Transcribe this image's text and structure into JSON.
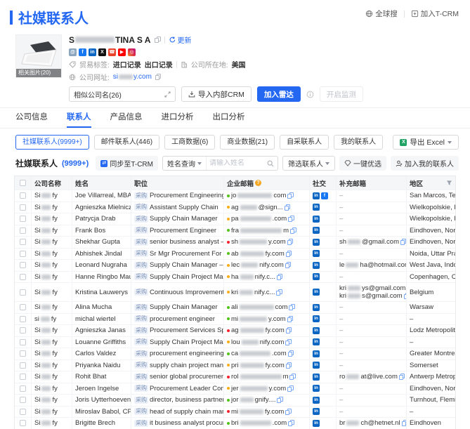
{
  "header": {
    "title": "社媒联系人"
  },
  "top_actions": {
    "global_search": "全球搜",
    "add_tcrm": "加入T-CRM"
  },
  "company": {
    "name_start": "S",
    "name_end": "TINA S A",
    "refresh_label": "更新",
    "image_label": "相关图片(20)",
    "social_platforms": [
      "website",
      "facebook",
      "linkedin",
      "x",
      "phone",
      "youtube",
      "instagram"
    ],
    "trade_label": "贸易标签:",
    "import_records": "进口记录",
    "export_records": "出口记录",
    "location_label": "公司所在地:",
    "location_value": "美国",
    "website_label": "公司网址:",
    "website_start": "si",
    "website_end": "y.com",
    "similar_companies": "相似公司名(26)",
    "import_crm": "导入内部CRM",
    "add_radar": "加入雷达",
    "start_monitor": "开启监测"
  },
  "tabs": [
    {
      "label": "公司信息",
      "active": false
    },
    {
      "label": "联系人",
      "active": true
    },
    {
      "label": "产品信息",
      "active": false
    },
    {
      "label": "进口分析",
      "active": false
    },
    {
      "label": "出口分析",
      "active": false
    }
  ],
  "filters": {
    "pills": [
      {
        "label": "社媒联系人(9999+)",
        "active": true
      },
      {
        "label": "邮件联系人(446)",
        "active": false
      },
      {
        "label": "工商数据(6)",
        "active": false
      },
      {
        "label": "商业数据(21)",
        "active": false
      },
      {
        "label": "自采联系人",
        "active": false
      },
      {
        "label": "我的联系人",
        "active": false
      }
    ],
    "export_label": "导出 Excel"
  },
  "toolbar": {
    "section_title": "社媒联系人",
    "section_count": "(9999+)",
    "sync_label": "同步至T-CRM",
    "name_query": "姓名查询",
    "search_placeholder": "请输入姓名",
    "filter_contacts": "筛选联系人",
    "one_click": "一键优选",
    "add_my_contacts": "加入我的联系人"
  },
  "table": {
    "columns": [
      "公司名称",
      "姓名",
      "职位",
      "企业邮箱",
      "社交",
      "补充邮箱",
      "地区"
    ],
    "tag_label": "采购",
    "empty_placeholder": "–",
    "rows": [
      {
        "company": {
          "pre": "Si",
          "post": "fy"
        },
        "name": "Joe Villarreal, MBA",
        "position": "Procurement Engineering",
        "email": {
          "status": "green",
          "pre": "jo",
          "post": "com"
        },
        "social": [
          "linkedin",
          "facebook"
        ],
        "extra": [],
        "region": "San Marcos, Texas,..."
      },
      {
        "company": {
          "pre": "Si",
          "post": "fy"
        },
        "name": "Agnieszka Mielniczuk",
        "position": "Assistant Supply Chain",
        "email": {
          "status": "yellow",
          "pre": "ag",
          "post": "@sign..."
        },
        "social": [
          "linkedin"
        ],
        "extra": [],
        "region": "Wielkopolskie, Poland"
      },
      {
        "company": {
          "pre": "Si",
          "post": "fy"
        },
        "name": "Patrycja Drab",
        "position": "Supply Chain Manager",
        "email": {
          "status": "yellow",
          "pre": "pa",
          "post": ".com"
        },
        "social": [
          "linkedin"
        ],
        "extra": [],
        "region": "Wielkopolskie, Poland"
      },
      {
        "company": {
          "pre": "Si",
          "post": "fy"
        },
        "name": "Frank Bos",
        "position": "Procurement Engineer",
        "email": {
          "status": "green",
          "pre": "fra",
          "post": "m"
        },
        "social": [
          "linkedin"
        ],
        "extra": [],
        "region": "Eindhoven, North Br..."
      },
      {
        "company": {
          "pre": "Si",
          "post": "fy"
        },
        "name": "Shekhar Gupta",
        "position": "senior business analyst – scm...",
        "email": {
          "status": "red",
          "pre": "sh",
          "post": "y.com"
        },
        "social": [
          "linkedin"
        ],
        "extra": [
          {
            "pre": "sh",
            "post": "@gmail.com"
          }
        ],
        "region": "Eindhoven, North Br..."
      },
      {
        "company": {
          "pre": "Si",
          "post": "fy"
        },
        "name": "Abhishek Jindal",
        "position": "Sr Mgr Procurement For Led ...",
        "email": {
          "status": "green",
          "pre": "ab",
          "post": "fy.com"
        },
        "social": [
          "linkedin"
        ],
        "extra": [],
        "region": "Noida, Uttar Prades..."
      },
      {
        "company": {
          "pre": "Si",
          "post": "fy"
        },
        "name": "Leonard Nugraha",
        "position": "Supply Chain Manager – Finis...",
        "email": {
          "status": "yellow",
          "pre": "lec",
          "post": "nify.com"
        },
        "social": [
          "linkedin"
        ],
        "extra": [
          {
            "pre": "le",
            "post": "ha@hotmail.com"
          }
        ],
        "region": "West Java, Indonesia"
      },
      {
        "company": {
          "pre": "Si",
          "post": "fy"
        },
        "name": "Hanne Ringbo Maur...",
        "position": "Supply Chain Project Manager",
        "email": {
          "status": "yellow",
          "pre": "ha",
          "post": "nify.c..."
        },
        "social": [
          "linkedin"
        ],
        "extra": [],
        "region": "Copenhagen, Capit..."
      },
      {
        "company": {
          "pre": "Si",
          "post": "fy"
        },
        "name": "Kristina Lauwerys",
        "position": "Continuous Improvement Man...",
        "email": {
          "status": "yellow",
          "pre": "kri",
          "post": "nify.c..."
        },
        "social": [
          "linkedin"
        ],
        "extra": [
          {
            "pre": "kri",
            "post": "ys@gmail.com"
          },
          {
            "pre": "kri",
            "post": "s@gmail.com"
          }
        ],
        "region": "Belgium"
      },
      {
        "company": {
          "pre": "Si",
          "post": "fy"
        },
        "name": "Alina Mucha",
        "position": "Supply Chain Manager",
        "email": {
          "status": "green",
          "pre": "ali",
          "post": "com"
        },
        "social": [
          "linkedin"
        ],
        "extra": [],
        "region": "Warsaw"
      },
      {
        "company": {
          "pre": "si",
          "post": "fy"
        },
        "name": "michal wiertel",
        "position": "procurement engineer",
        "email": {
          "status": "green",
          "pre": "mi",
          "post": "y.com"
        },
        "social": [
          "linkedin"
        ],
        "extra": [],
        "region": "–"
      },
      {
        "company": {
          "pre": "Si",
          "post": "fy"
        },
        "name": "Agnieszka Janas",
        "position": "Procurement Services Specialist",
        "email": {
          "status": "red",
          "pre": "ag",
          "post": "fy.com"
        },
        "social": [
          "linkedin"
        ],
        "extra": [],
        "region": "Lodz Metropolitan ..."
      },
      {
        "company": {
          "pre": "Si",
          "post": "fy"
        },
        "name": "Louanne Griffiths",
        "position": "Supply Chain Project Manager",
        "email": {
          "status": "yellow",
          "pre": "lou",
          "post": "nify.com"
        },
        "social": [
          "linkedin"
        ],
        "extra": [],
        "region": "–"
      },
      {
        "company": {
          "pre": "Si",
          "post": "fy"
        },
        "name": "Carlos Valdez",
        "position": "procurement engineering",
        "email": {
          "status": "green",
          "pre": "ca",
          "post": ".com"
        },
        "social": [
          "linkedin"
        ],
        "extra": [],
        "region": "Greater Montreal M..."
      },
      {
        "company": {
          "pre": "Si",
          "post": "fy"
        },
        "name": "Priyanka Naidu",
        "position": "supply chain project manager",
        "email": {
          "status": "yellow",
          "pre": "pri",
          "post": "fy.com"
        },
        "social": [
          "linkedin"
        ],
        "extra": [],
        "region": "Somerset"
      },
      {
        "company": {
          "pre": "Si",
          "post": "fy"
        },
        "name": "Rohit Bhat",
        "position": "senior global procurement ma...",
        "email": {
          "status": "red",
          "pre": "rol",
          "post": "m"
        },
        "social": [
          "linkedin"
        ],
        "extra": [
          {
            "pre": "ro",
            "post": "at@live.com"
          }
        ],
        "region": "Antwerp Metropolit..."
      },
      {
        "company": {
          "pre": "Si",
          "post": "fy"
        },
        "name": "Jeroen Ingelse",
        "position": "Procurement Leader Conventi...",
        "email": {
          "status": "yellow",
          "pre": "jer",
          "post": "y.com"
        },
        "social": [
          "linkedin"
        ],
        "extra": [],
        "region": "Eindhoven, North Br..."
      },
      {
        "company": {
          "pre": "Si",
          "post": "fy"
        },
        "name": "Joris Uytterhoeven",
        "position": "director, business partner pro...",
        "email": {
          "status": "green",
          "pre": "jor",
          "post": "gnify...."
        },
        "social": [
          "linkedin"
        ],
        "extra": [],
        "region": "Turnhout, Flemish R..."
      },
      {
        "company": {
          "pre": "Si",
          "post": "fy"
        },
        "name": "Miroslav Babol, CPIM",
        "position": "head of supply chain manage...",
        "email": {
          "status": "red",
          "pre": "mi",
          "post": "fy.com"
        },
        "social": [
          "linkedin"
        ],
        "extra": [],
        "region": "–"
      },
      {
        "company": {
          "pre": "Si",
          "post": "fy"
        },
        "name": "Brigitte Brech",
        "position": "it business analyst procurement",
        "email": {
          "status": "green",
          "pre": "bri",
          "post": ".com"
        },
        "social": [
          "linkedin"
        ],
        "extra": [
          {
            "pre": "br",
            "post": "ch@hetnet.nl"
          }
        ],
        "region": "Eindhoven"
      }
    ]
  },
  "colors": {
    "accent": "#2468f2",
    "green": "#52c41a",
    "yellow": "#faad14",
    "red": "#f5222d",
    "linkedin": "#0a66c2",
    "facebook": "#1877f2"
  }
}
